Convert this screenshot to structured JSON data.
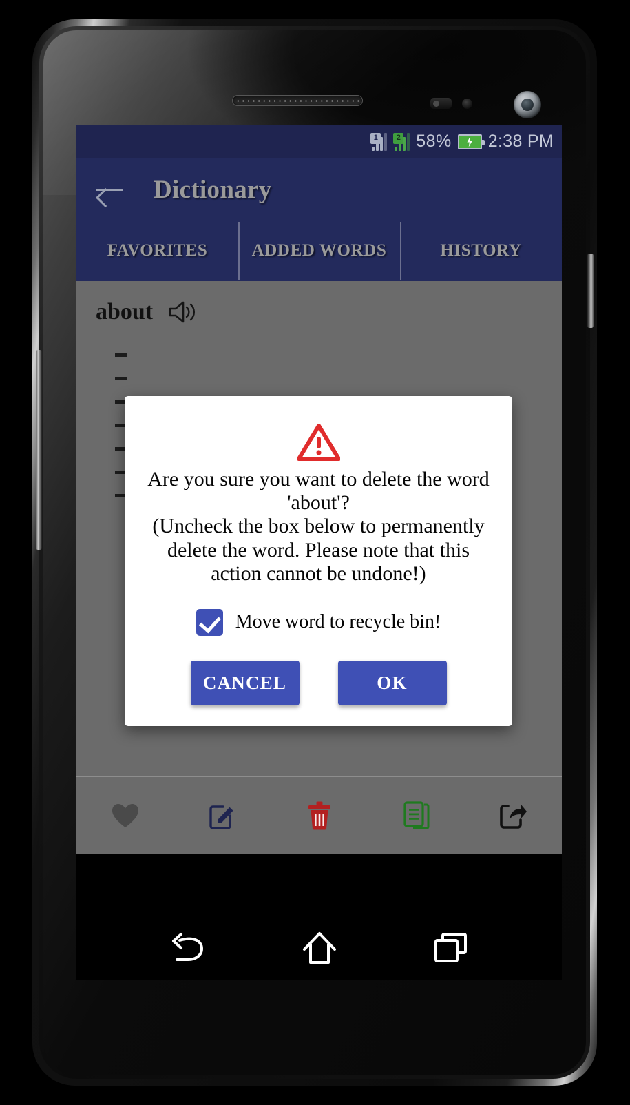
{
  "statusbar": {
    "sim1_label": "1",
    "sim2_label": "2",
    "battery_percent": "58%",
    "time": "2:38 PM"
  },
  "appbar": {
    "back_icon": "back-arrow-icon",
    "title": "Dictionary"
  },
  "tabs": [
    {
      "label": "FAVORITES"
    },
    {
      "label": "ADDED WORDS"
    },
    {
      "label": "HISTORY"
    }
  ],
  "content": {
    "word": "about",
    "speaker_icon": "speaker-icon",
    "definitions": [
      {
        "text": ""
      },
      {
        "text": ""
      },
      {
        "text": ""
      },
      {
        "text": ""
      },
      {
        "text": ""
      },
      {
        "text": ""
      },
      {
        "text": ""
      }
    ]
  },
  "toolbar": [
    {
      "name": "favorite",
      "icon": "heart-icon",
      "color": "#4a4a4a"
    },
    {
      "name": "edit",
      "icon": "edit-square-icon",
      "color": "#1e2450"
    },
    {
      "name": "delete",
      "icon": "trash-icon",
      "color": "#b32020"
    },
    {
      "name": "copy",
      "icon": "document-icon",
      "color": "#1f7a1f"
    },
    {
      "name": "share",
      "icon": "share-icon",
      "color": "#111111"
    }
  ],
  "dialog": {
    "warning_icon": "warning-triangle-icon",
    "message": "Are you sure you want to delete the word 'about'?\n(Uncheck the box below to permanently delete the word. Please note that this action cannot be undone!)",
    "checkbox": {
      "checked": true,
      "label": "Move word to recycle bin!"
    },
    "cancel_label": "CANCEL",
    "ok_label": "OK",
    "accent_color": "#3f50b5"
  },
  "navbar": {
    "back_icon": "nav-back-icon",
    "home_icon": "nav-home-icon",
    "recents_icon": "nav-recents-icon"
  },
  "colors": {
    "appbar": "#232a5c",
    "statusbar": "#1f2450",
    "accent": "#3f50b5",
    "scrim_content": "#6b6b6b"
  }
}
